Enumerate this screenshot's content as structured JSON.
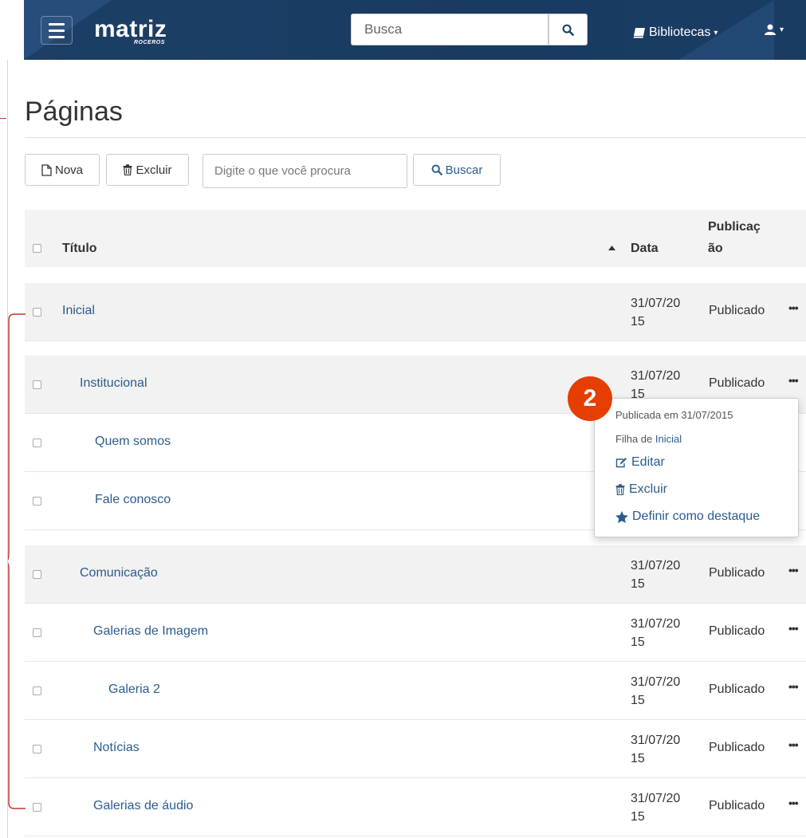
{
  "navbar": {
    "logo": "matriz",
    "logo_sub": "ROCEROS",
    "search_placeholder": "Busca",
    "libraries_label": "Bibliotecas"
  },
  "page": {
    "title": "Páginas"
  },
  "toolbar": {
    "new_label": "Nova",
    "delete_label": "Excluir",
    "search_placeholder": "Digite o que você procura",
    "search_button_label": "Buscar"
  },
  "table": {
    "columns": {
      "title": "Título",
      "date": "Data",
      "publication_line1": "Publicaç",
      "publication_line2": "ão"
    },
    "rows": [
      {
        "title": "Inicial",
        "date1": "31/07/20",
        "date2": "15",
        "status": "Publicado",
        "actions": "•••"
      },
      {
        "title": "Institucional",
        "date1": "31/07/20",
        "date2": "15",
        "status": "Publicado",
        "actions": "•••"
      },
      {
        "title": "Quem somos",
        "date1": "",
        "date2": "",
        "status": "",
        "actions": ""
      },
      {
        "title": "Fale conosco",
        "date1": "",
        "date2": "",
        "status": "",
        "actions": ""
      },
      {
        "title": "Comunicação",
        "date1": "31/07/20",
        "date2": "15",
        "status": "Publicado",
        "actions": "•••"
      },
      {
        "title": "Galerias de Imagem",
        "date1": "31/07/20",
        "date2": "15",
        "status": "Publicado",
        "actions": "•••"
      },
      {
        "title": "Galeria 2",
        "date1": "31/07/20",
        "date2": "15",
        "status": "Publicado",
        "actions": "•••"
      },
      {
        "title": "Notícias",
        "date1": "31/07/20",
        "date2": "15",
        "status": "Publicado",
        "actions": "•••"
      },
      {
        "title": "Galerias de áudio",
        "date1": "31/07/20",
        "date2": "15",
        "status": "Publicado",
        "actions": "•••"
      }
    ]
  },
  "context_menu": {
    "published_on": "Publicada em 31/07/2015",
    "child_of_prefix": "Filha de ",
    "child_of_link": "Inicial",
    "edit_label": "Editar",
    "delete_label": "Excluir",
    "highlight_label": "Definir como destaque"
  },
  "annotation": {
    "badge": "2",
    "color": "#e53e00"
  },
  "colors": {
    "navbar": "#1d3f66",
    "link": "#2a5c8f",
    "row_alt": "#f2f2f2"
  }
}
